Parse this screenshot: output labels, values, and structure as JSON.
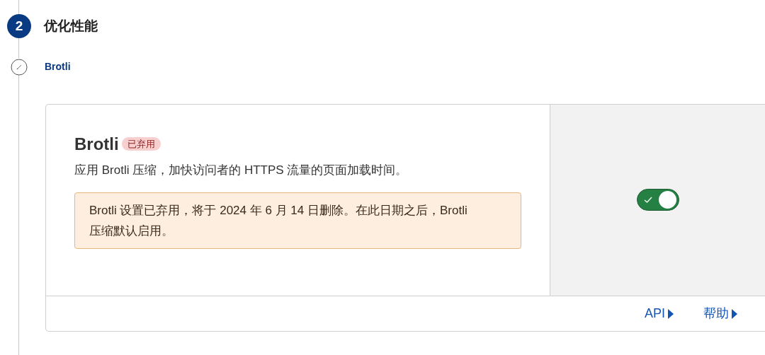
{
  "step": {
    "number": "2",
    "title": "优化性能"
  },
  "substep": {
    "title": "Brotli"
  },
  "card": {
    "title": "Brotli",
    "badge": "已弃用",
    "description": "应用 Brotli 压缩，加快访问者的 HTTPS 流量的页面加载时间。",
    "alert": "Brotli 设置已弃用，将于 2024 年 6 月 14 日删除。在此日期之后，Brotli 压缩默认启用。",
    "toggle": {
      "on": true
    },
    "links": [
      {
        "label": "API"
      },
      {
        "label": "帮助"
      }
    ]
  }
}
